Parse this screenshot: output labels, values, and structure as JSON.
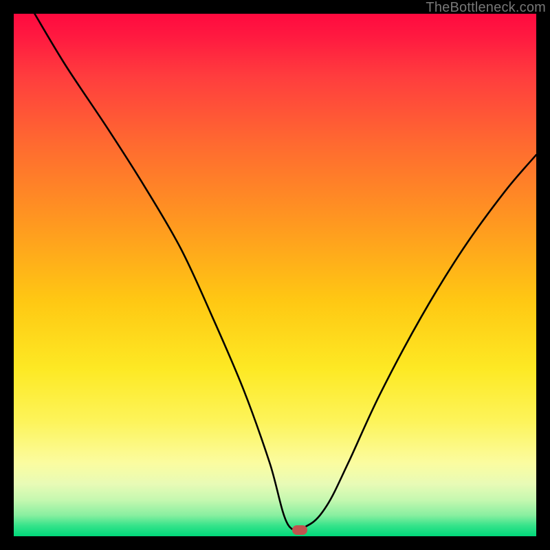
{
  "attribution": "TheBottleneck.com",
  "marker": {
    "x_frac": 0.547,
    "y_frac": 0.988
  },
  "chart_data": {
    "type": "line",
    "title": "",
    "xlabel": "",
    "ylabel": "",
    "xlim": [
      0,
      100
    ],
    "ylim": [
      0,
      100
    ],
    "series": [
      {
        "name": "bottleneck-curve",
        "x": [
          4,
          10,
          18,
          25,
          32,
          38,
          44,
          49,
          52.5,
          56.5,
          60,
          64,
          70,
          78,
          86,
          94,
          100
        ],
        "y": [
          100,
          90,
          78,
          67,
          55,
          42,
          28,
          14,
          2.2,
          2.2,
          6,
          14,
          27,
          42,
          55,
          66,
          73
        ]
      }
    ],
    "gradient_stops": [
      {
        "pos": 0,
        "color": "#ff0a3f"
      },
      {
        "pos": 25,
        "color": "#ff6a30"
      },
      {
        "pos": 55,
        "color": "#ffc813"
      },
      {
        "pos": 78,
        "color": "#fdf45a"
      },
      {
        "pos": 93,
        "color": "#c6f8b0"
      },
      {
        "pos": 100,
        "color": "#00d87a"
      }
    ],
    "marker": {
      "x": 54.7,
      "y": 1.2,
      "color": "#c0534e"
    }
  }
}
